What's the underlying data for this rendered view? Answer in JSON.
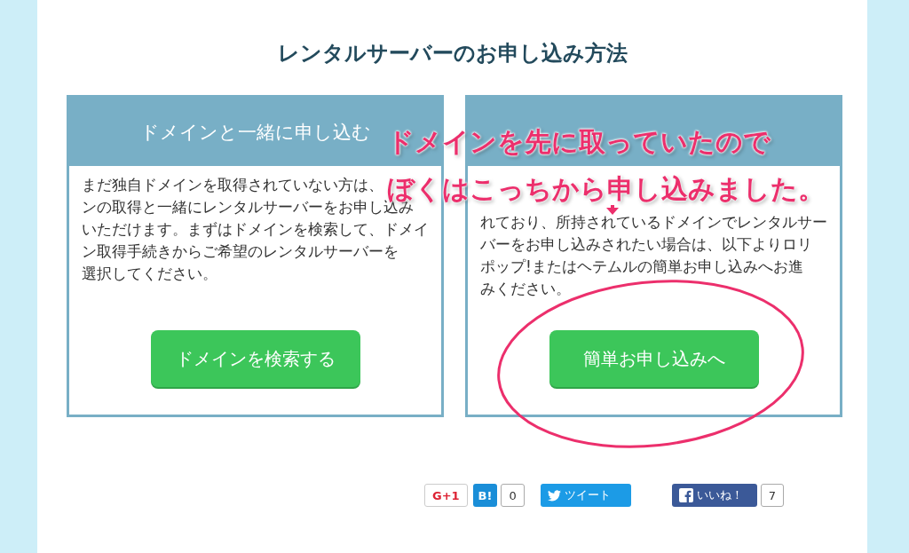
{
  "title": "レンタルサーバーのお申し込み方法",
  "cards": [
    {
      "heading": "ドメインと一緒に申し込む",
      "body": [
        "まだ独自ドメインを取得されていない方は、",
        "ンの取得と一緒にレンタルサーバーをお申し込み",
        "いただけます。まずはドメインを検索して、ドメイ",
        "ン取得手続きからご希望のレンタルサーバーを",
        "選択してください。"
      ],
      "button": "ドメインを検索する"
    },
    {
      "body": [
        "れており、所持されているドメインでレンタルサー",
        "バーをお申し込みされたい場合は、以下よりロリ",
        "ポップ!またはヘテムルの簡単お申し込みへお進",
        "みください。"
      ],
      "button": "簡単お申し込みへ"
    }
  ],
  "annotation": {
    "lines": [
      "ドメインを先に取っていたので",
      "ぼくはこっちから申し込みました。"
    ]
  },
  "share": [
    {
      "kind": "gplus",
      "label": "G+1"
    },
    {
      "kind": "hatena",
      "label": "B!",
      "count": "0"
    },
    {
      "kind": "tweet",
      "label": "ツイート"
    },
    {
      "kind": "facebook",
      "label": "いいね！",
      "count": "7"
    }
  ]
}
